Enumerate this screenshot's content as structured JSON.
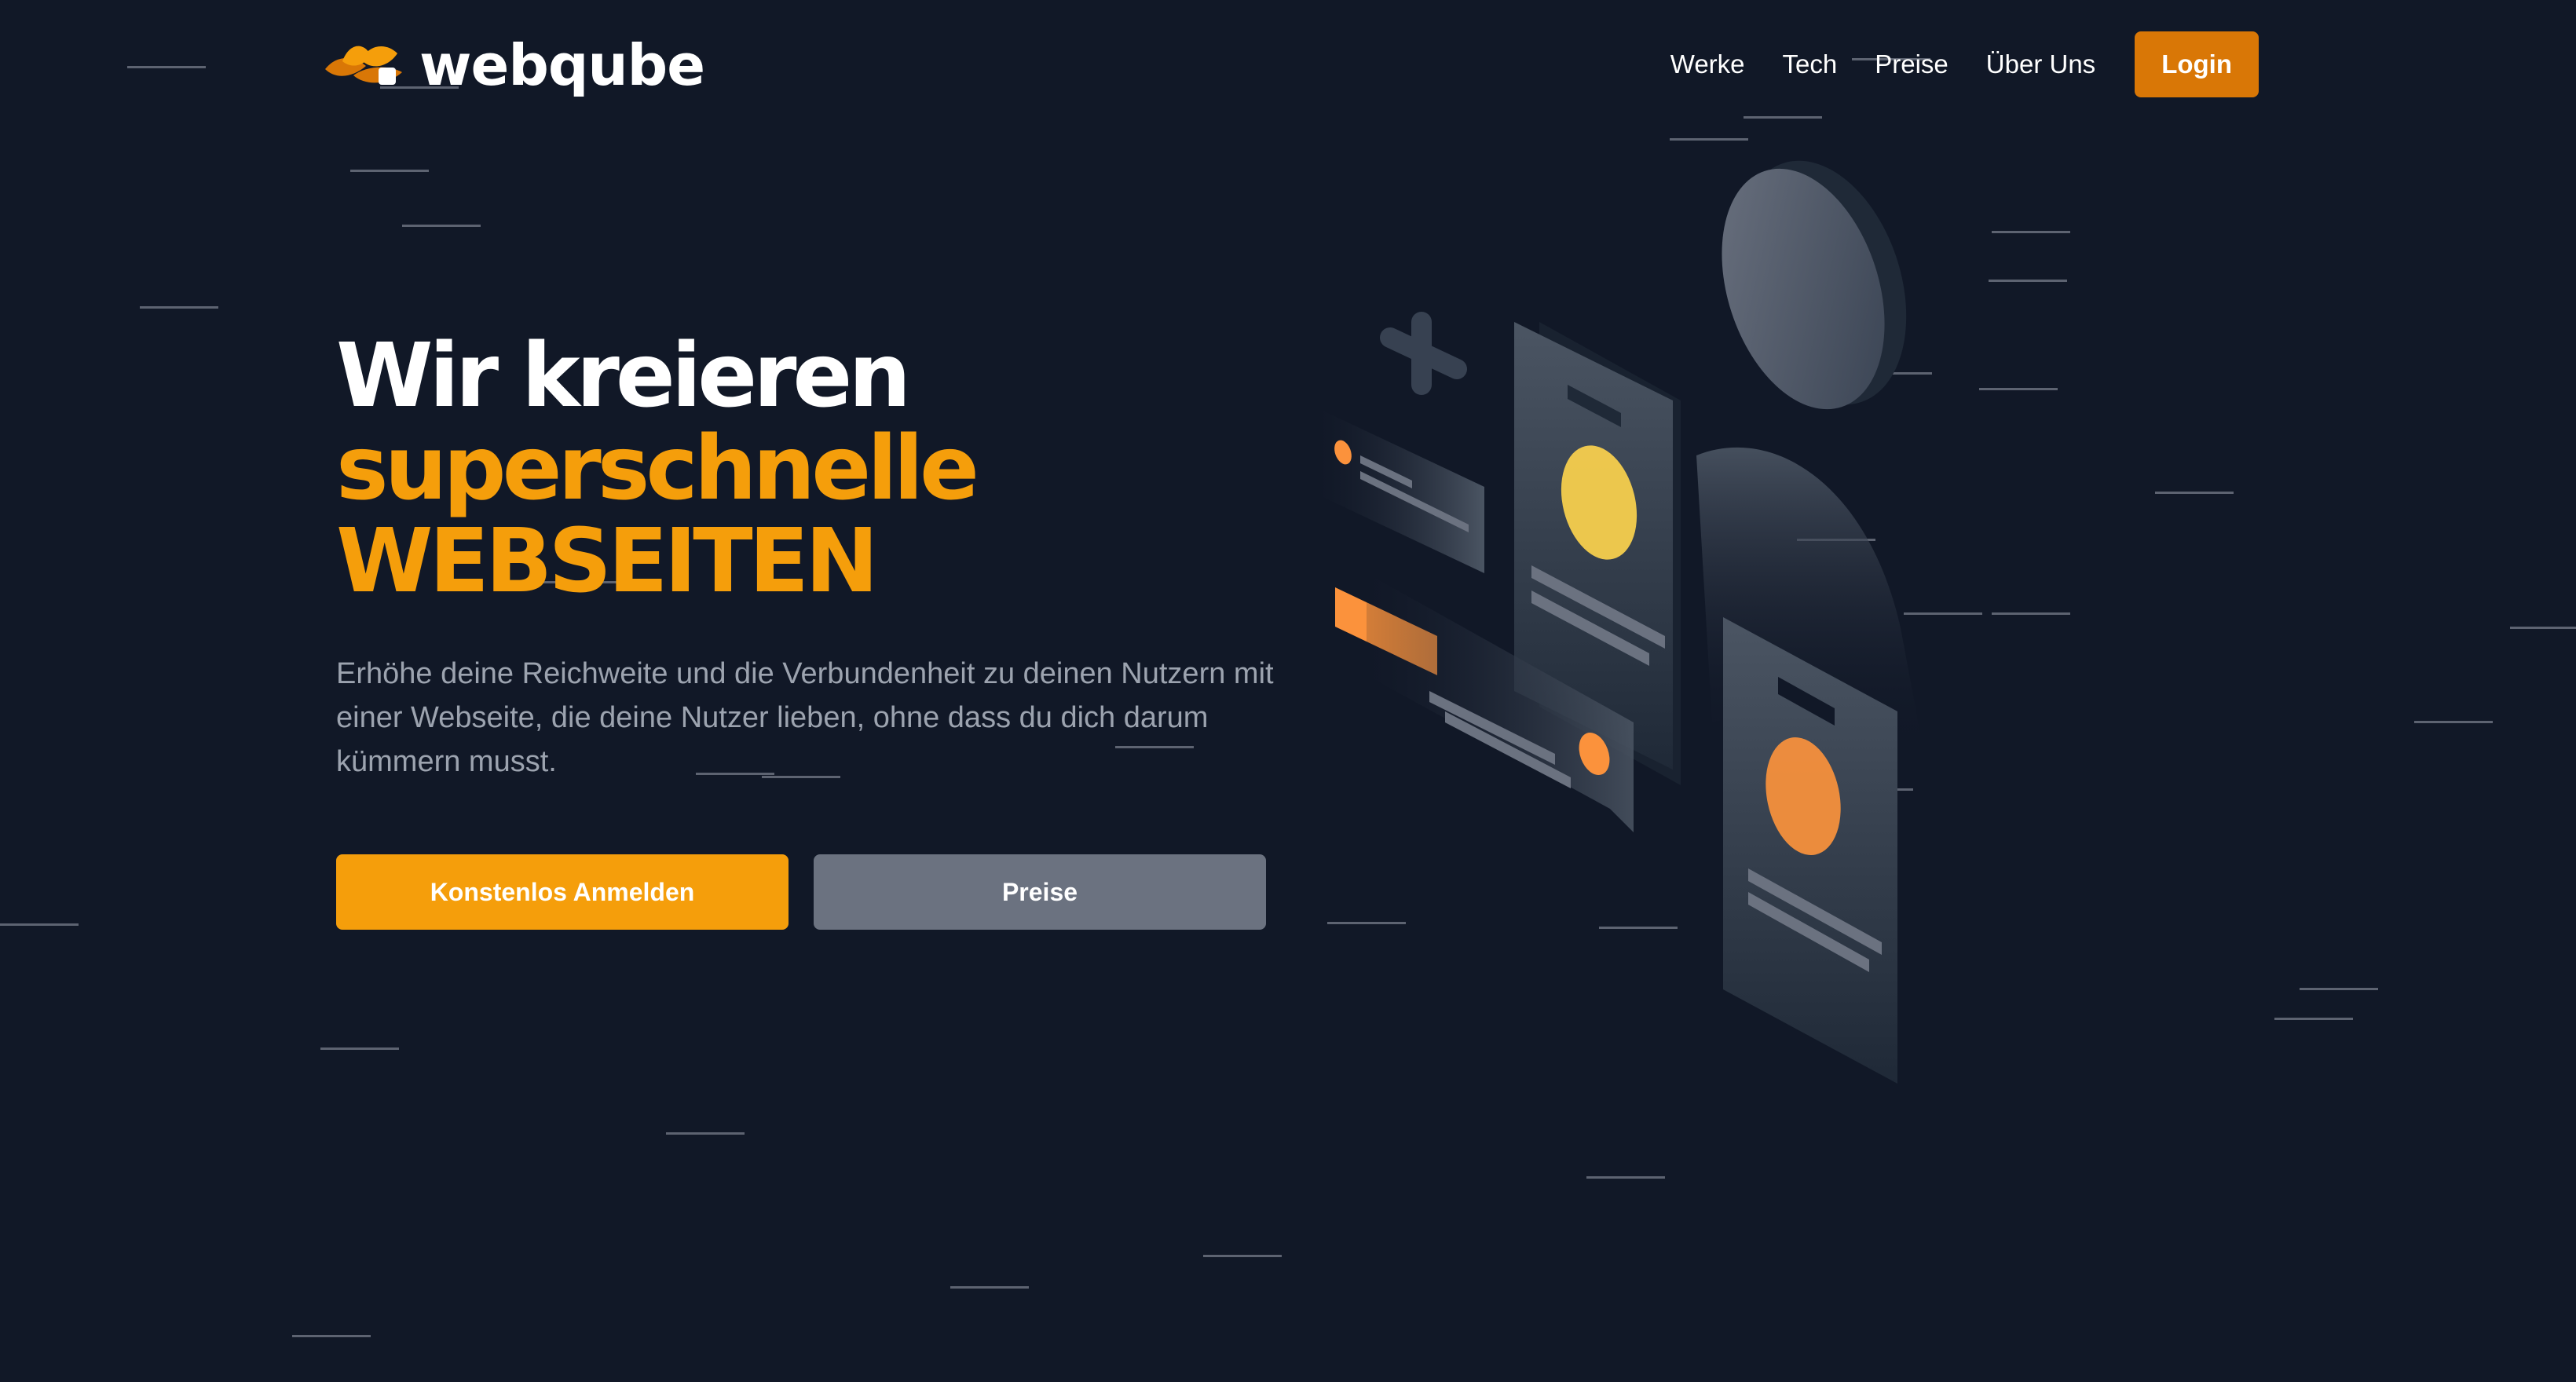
{
  "brand": {
    "name": "webqube",
    "logo_icon": "lotus-flame-icon",
    "accent": "#d97706"
  },
  "nav": {
    "items": [
      {
        "label": "Werke"
      },
      {
        "label": "Tech"
      },
      {
        "label": "Preise"
      },
      {
        "label": "Über Uns"
      }
    ],
    "login_label": "Login"
  },
  "hero": {
    "headline_line1": "Wir kreieren",
    "headline_line2": "superschnelle",
    "headline_line3": "WEBSEITEN",
    "lead": "Erhöhe deine Reichweite und die Verbundenheit zu deinen Nutzern mit einer Webseite, die deine Nutzer lieben, ohne dass du dich darum kümmern musst.",
    "primary_cta": "Konstenlos Anmelden",
    "secondary_cta": "Preise"
  },
  "colors": {
    "background": "#111827",
    "headline_white": "#ffffff",
    "headline_orange": "#f59e0b",
    "text_muted": "#9ca3af",
    "button_primary": "#f59e0b",
    "button_secondary": "#6b7280",
    "login_button": "#d97706"
  },
  "illustration": {
    "icon": "isometric-person-with-devices-illustration"
  }
}
